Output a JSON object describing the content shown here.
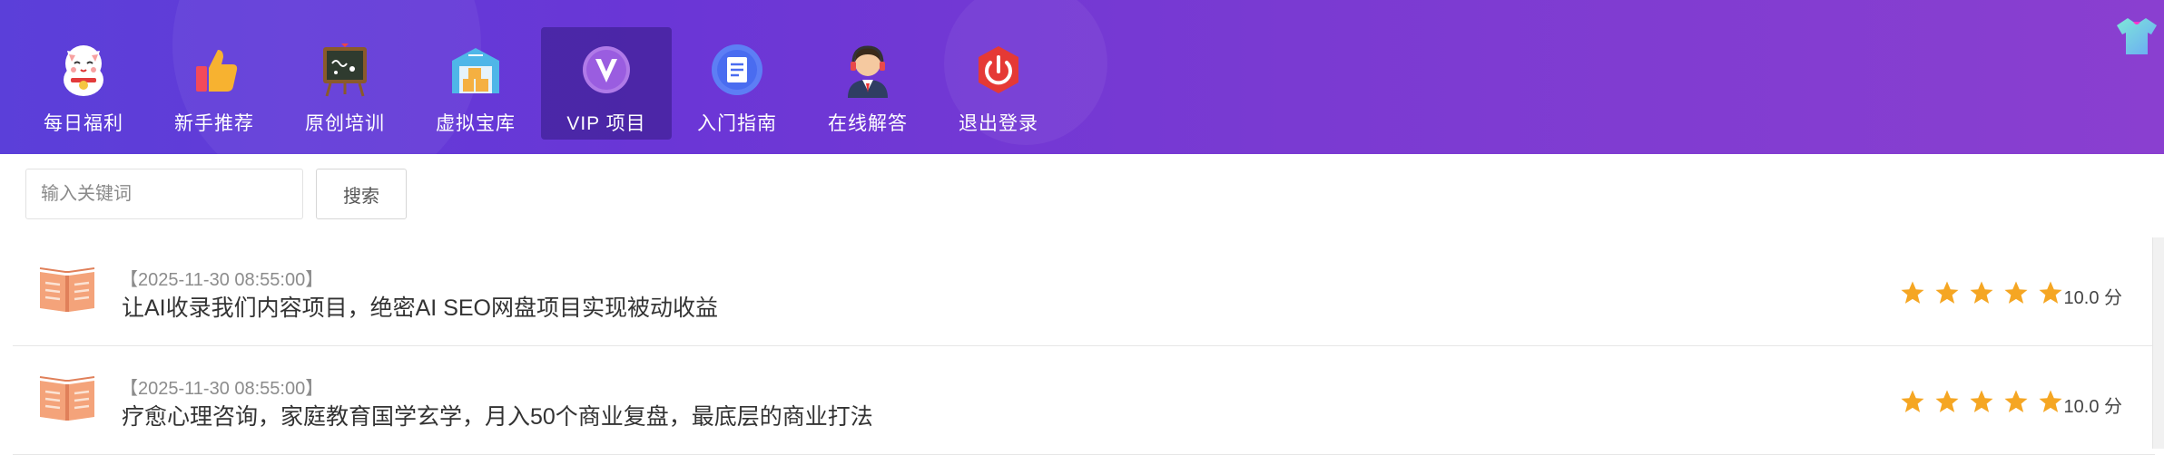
{
  "nav": {
    "items": [
      {
        "label": "每日福利",
        "icon": "lucky-cat-icon"
      },
      {
        "label": "新手推荐",
        "icon": "thumbs-up-icon"
      },
      {
        "label": "原创培训",
        "icon": "chalkboard-icon"
      },
      {
        "label": "虚拟宝库",
        "icon": "warehouse-icon"
      },
      {
        "label": "VIP 项目",
        "icon": "vip-icon"
      },
      {
        "label": "入门指南",
        "icon": "document-icon"
      },
      {
        "label": "在线解答",
        "icon": "support-agent-icon"
      },
      {
        "label": "退出登录",
        "icon": "power-icon"
      }
    ],
    "active_index": 4
  },
  "corner_icon": "tshirt-icon",
  "search": {
    "placeholder": "输入关键词",
    "value": "",
    "button_label": "搜索"
  },
  "list": {
    "items": [
      {
        "date": "【2025-11-30 08:55:00】",
        "title": "让AI收录我们内容项目，绝密AI SEO网盘项目实现被动收益",
        "stars": 5,
        "score": "10.0 分"
      },
      {
        "date": "【2025-11-30 08:55:00】",
        "title": "疗愈心理咨询，家庭教育国学玄学，月入50个商业复盘，最底层的商业打法",
        "stars": 5,
        "score": "10.0 分"
      }
    ]
  },
  "colors": {
    "header_gradient_start": "#5b3fd9",
    "header_gradient_end": "#8a3fd0",
    "star": "#f5a623",
    "book": "#f4a37a"
  }
}
